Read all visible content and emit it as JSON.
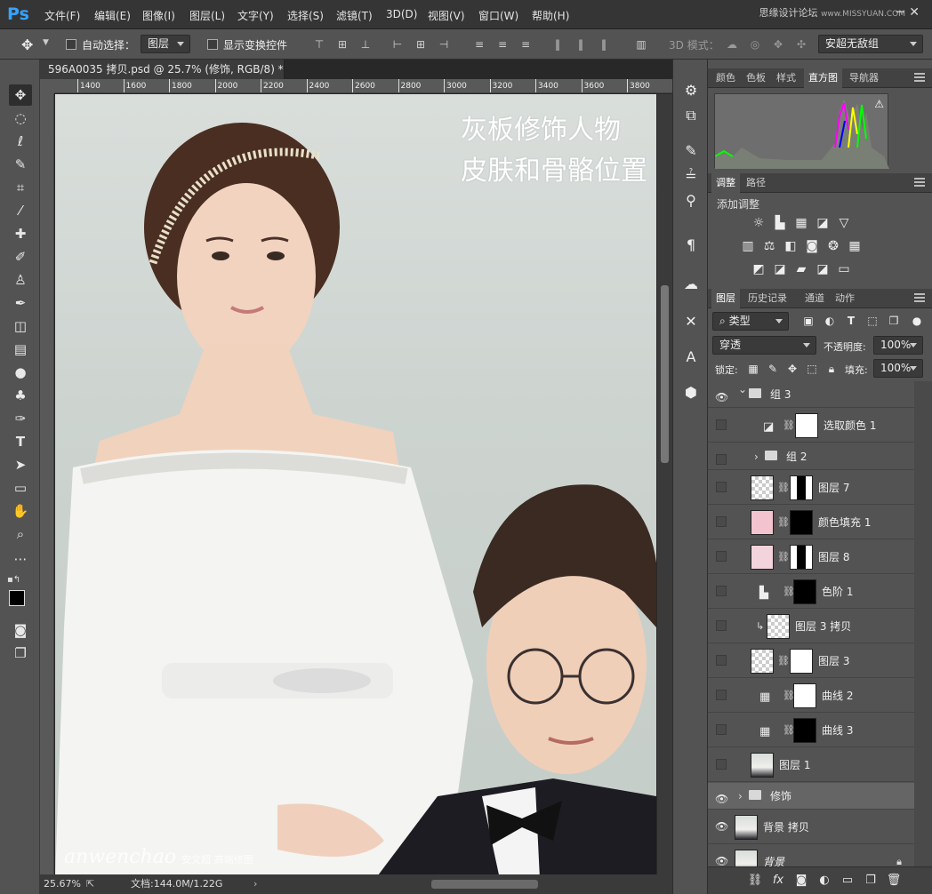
{
  "app": {
    "logo": "Ps",
    "watermark": "思缘设计论坛",
    "watermark_url": "www.MISSYUAN.COM"
  },
  "menu": [
    "文件(F)",
    "编辑(E)",
    "图像(I)",
    "图层(L)",
    "文字(Y)",
    "选择(S)",
    "滤镜(T)",
    "3D(D)",
    "视图(V)",
    "窗口(W)",
    "帮助(H)"
  ],
  "options": {
    "auto_select_label": "自动选择：",
    "auto_select_value": "图层",
    "show_transform_label": "显示变换控件",
    "mode3d_label": "3D 模式：",
    "workspace_value": "安超无敌组"
  },
  "document": {
    "tab_title": "596A0035 拷贝.psd @ 25.7% (修饰, RGB/8) *",
    "ruler_ticks": [
      "1400",
      "1600",
      "1800",
      "2000",
      "2200",
      "2400",
      "2600",
      "2800",
      "3000",
      "3200",
      "3400",
      "3600",
      "3800"
    ],
    "caption_line1": "灰板修饰人物",
    "caption_line2": "皮肤和骨骼位置",
    "brand": "anwenchao",
    "brand_sub": "安文超 高端修图",
    "zoom": "25.67%",
    "doc_size": "文档:144.0M/1.22G"
  },
  "panels": {
    "top_tabs": [
      "颜色",
      "色板",
      "样式",
      "直方图",
      "导航器"
    ],
    "top_active": 3,
    "adjust_tabs": [
      "调整",
      "路径"
    ],
    "adjust_title": "添加调整",
    "layer_tabs": [
      "图层",
      "历史记录",
      "通道",
      "动作"
    ],
    "filter_kind": "类型",
    "blend_mode": "穿透",
    "opacity_label": "不透明度:",
    "opacity_value": "100%",
    "lock_label": "锁定:",
    "fill_label": "填充:",
    "fill_value": "100%"
  },
  "layers": [
    {
      "name": "组 3",
      "visible": true,
      "type": "group",
      "indent": 0
    },
    {
      "name": "选取颜色 1",
      "visible": false,
      "type": "adjust",
      "indent": 1
    },
    {
      "name": "组 2",
      "visible": false,
      "type": "group-closed",
      "indent": 1
    },
    {
      "name": "图层 7",
      "visible": false,
      "type": "masked",
      "indent": 1
    },
    {
      "name": "颜色填充 1",
      "visible": false,
      "type": "fill",
      "indent": 1
    },
    {
      "name": "图层 8",
      "visible": false,
      "type": "masked-pink",
      "indent": 1
    },
    {
      "name": "色阶 1",
      "visible": false,
      "type": "levels",
      "indent": 1
    },
    {
      "name": "图层 3 拷贝",
      "visible": false,
      "type": "clipped",
      "indent": 1
    },
    {
      "name": "图层 3",
      "visible": false,
      "type": "masked-white",
      "indent": 1
    },
    {
      "name": "曲线 2",
      "visible": false,
      "type": "curves",
      "indent": 1
    },
    {
      "name": "曲线 3",
      "visible": false,
      "type": "curves-dark",
      "indent": 1
    },
    {
      "name": "图层 1",
      "visible": false,
      "type": "photo",
      "indent": 1
    },
    {
      "name": "修饰",
      "visible": true,
      "type": "group-closed",
      "indent": 0,
      "selected": true
    },
    {
      "name": "背景 拷贝",
      "visible": true,
      "type": "photo",
      "indent": 0
    },
    {
      "name": "背景",
      "visible": true,
      "type": "background",
      "indent": 0
    }
  ],
  "colors": {
    "accent": "#36a3ff",
    "panel": "#535353",
    "dark": "#282828"
  }
}
